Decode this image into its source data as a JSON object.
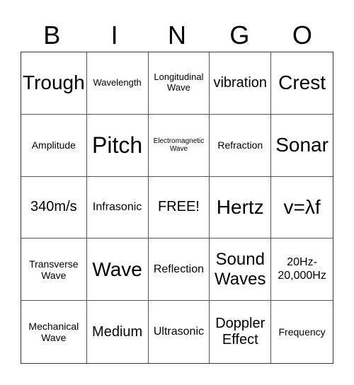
{
  "header": [
    "B",
    "I",
    "N",
    "G",
    "O"
  ],
  "cells": [
    {
      "text": "Trough",
      "size": "l"
    },
    {
      "text": "Wavelength",
      "size": "xs"
    },
    {
      "text": "Longitudinal Wave",
      "size": "xs"
    },
    {
      "text": "vibration",
      "size": "m"
    },
    {
      "text": "Crest",
      "size": "l"
    },
    {
      "text": "Amplitude",
      "size": "s"
    },
    {
      "text": "Pitch",
      "size": "xl"
    },
    {
      "text": "Electromagnetic Wave",
      "size": "xxs"
    },
    {
      "text": "Refraction",
      "size": "s"
    },
    {
      "text": "Sonar",
      "size": "l"
    },
    {
      "text": "340m/s",
      "size": "m"
    },
    {
      "text": "Infrasonic",
      "size": "sm"
    },
    {
      "text": "FREE!",
      "size": "m"
    },
    {
      "text": "Hertz",
      "size": "l"
    },
    {
      "text": "v=λf",
      "size": "l"
    },
    {
      "text": "Transverse Wave",
      "size": "s"
    },
    {
      "text": "Wave",
      "size": "l"
    },
    {
      "text": "Reflection",
      "size": "sm"
    },
    {
      "text": "Sound Waves",
      "size": "ml"
    },
    {
      "text": "20Hz- 20,000Hz",
      "size": "sm"
    },
    {
      "text": "Mechanical Wave",
      "size": "s"
    },
    {
      "text": "Medium",
      "size": "m"
    },
    {
      "text": "Ultrasonic",
      "size": "sm"
    },
    {
      "text": "Doppler Effect",
      "size": "m"
    },
    {
      "text": "Frequency",
      "size": "s"
    }
  ]
}
